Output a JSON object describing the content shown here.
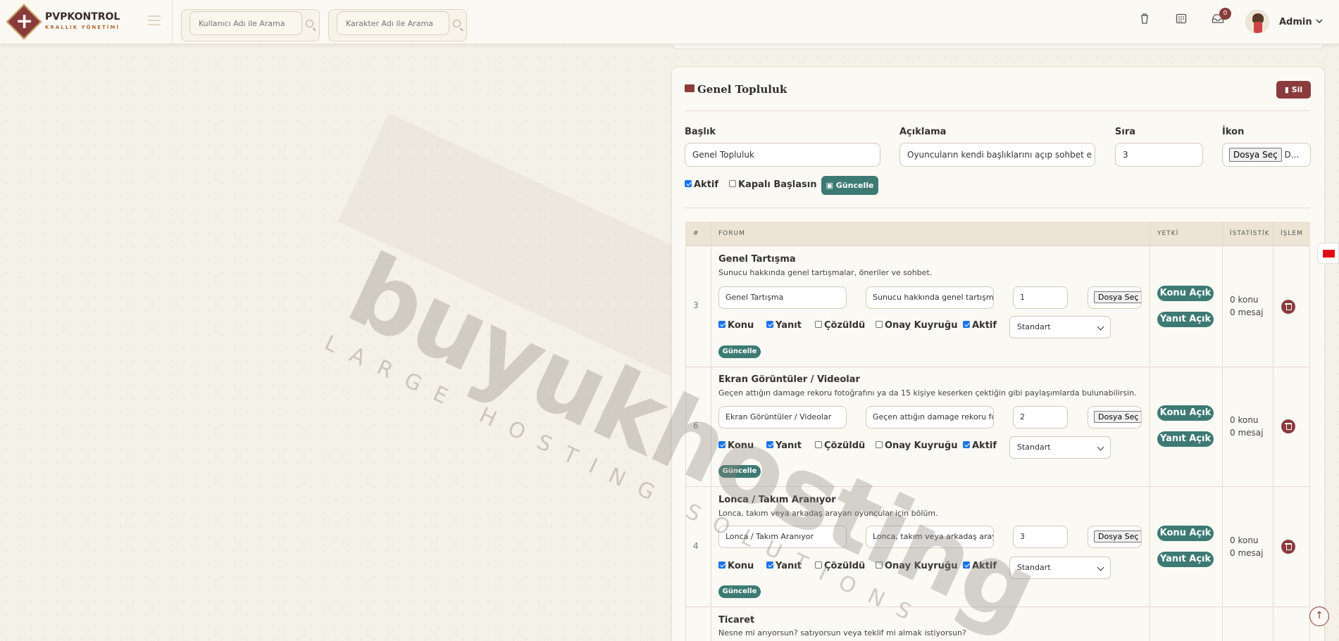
{
  "brand": {
    "title": "PVPKONTROL",
    "subtitle": "KRALLIK YÖNETİMİ"
  },
  "search": {
    "user_placeholder": "Kullanıcı Adı ile Arama",
    "char_placeholder": "Karakter Adı ile Arama"
  },
  "topbar": {
    "notification_count": "0",
    "admin_name": "Admin"
  },
  "category": {
    "title": "Genel Topluluk",
    "delete_label": "Sil",
    "fields": {
      "baslik_label": "Başlık",
      "baslik_value": "Genel Topluluk",
      "aciklama_label": "Açıklama",
      "aciklama_value": "Oyuncuların kendi başlıklarını açıp sohbet e",
      "sira_label": "Sıra",
      "sira_value": "3",
      "ikon_label": "İkon",
      "ikon_file_button": "Dosya Seç",
      "ikon_file_text": "D..."
    },
    "aktif_label": "Aktif",
    "kapali_label": "Kapalı Başlasın",
    "update_label": "Güncelle"
  },
  "table": {
    "headers": [
      "#",
      "FORUM",
      "YETKİ",
      "İSTATİSTİK",
      "İŞLEM"
    ],
    "rows": [
      {
        "order": "3",
        "title": "Genel Tartışma",
        "desc": "Sunucu hakkında genel tartışmalar, öneriler ve sohbet.",
        "name_input": "Genel Tartışma",
        "desc_input": "Sunucu hakkında genel tartışm",
        "sira": "1",
        "file_btn": "Dosya Seç",
        "konu": "Konu",
        "yanit": "Yanıt",
        "cozuldu": "Çözüldü",
        "onay": "Onay Kuyruğu",
        "aktif": "Aktif",
        "select": "Standart",
        "update": "Güncelle",
        "perm1": "Konu Açık",
        "perm2": "Yanıt Açık",
        "stat1": "0 konu",
        "stat2": "0 mesaj"
      },
      {
        "order": "6",
        "title": "Ekran Görüntüler / Videolar",
        "desc": "Geçen attığın damage rekoru fotoğrafını ya da 15 kişiye keserken çektiğin gibi paylaşımlarda bulunabilirsin.",
        "name_input": "Ekran Görüntüler / Videolar",
        "desc_input": "Geçen attığın damage rekoru fc",
        "sira": "2",
        "file_btn": "Dosya Seç",
        "konu": "Konu",
        "yanit": "Yanıt",
        "cozuldu": "Çözüldü",
        "onay": "Onay Kuyruğu",
        "aktif": "Aktif",
        "select": "Standart",
        "update": "Güncelle",
        "perm1": "Konu Açık",
        "perm2": "Yanıt Açık",
        "stat1": "0 konu",
        "stat2": "0 mesaj"
      },
      {
        "order": "4",
        "title": "Lonca / Takım Aranıyor",
        "desc": "Lonca, takım veya arkadaş arayan oyuncular için bölüm.",
        "name_input": "Lonca / Takım Aranıyor",
        "desc_input": "Lonca, takım veya arkadaş aray",
        "sira": "3",
        "file_btn": "Dosya Seç",
        "konu": "Konu",
        "yanit": "Yanıt",
        "cozuldu": "Çözüldü",
        "onay": "Onay Kuyruğu",
        "aktif": "Aktif",
        "select": "Standart",
        "update": "Güncelle",
        "perm1": "Konu Açık",
        "perm2": "Yanıt Açık",
        "stat1": "0 konu",
        "stat2": "0 mesaj"
      },
      {
        "order": "",
        "title": "Ticaret",
        "desc": "Nesne mi arıyorsun? satıyorsun veya teklif mi almak istiyorsun?"
      }
    ]
  },
  "watermark": {
    "main": "buyukhosting",
    "sub": "LARGE HOSTING SOLUTIONS"
  },
  "icons": {
    "trash": "trash-icon",
    "calendar": "calendar-icon",
    "inbox": "inbox-icon",
    "folder": "folder-open-icon",
    "save": "save-icon",
    "arrow_up": "arrow-up-icon",
    "flag": "turkey-flag-icon"
  },
  "colors": {
    "accent_red": "#8a3b3b",
    "accent_teal": "#3d7a74",
    "background": "#f4f1e8"
  }
}
